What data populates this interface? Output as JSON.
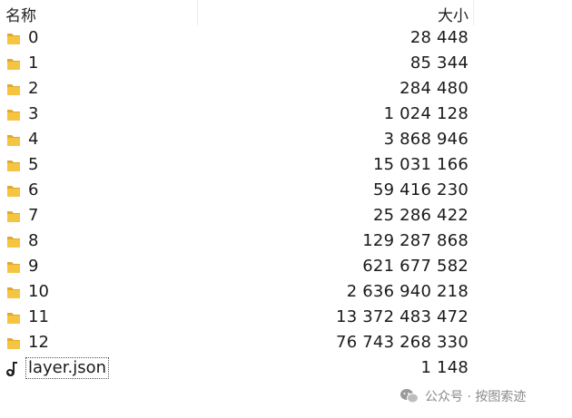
{
  "header": {
    "name_label": "名称",
    "size_label": "大小"
  },
  "files": [
    {
      "name": "0",
      "size": "28 448",
      "type": "folder"
    },
    {
      "name": "1",
      "size": "85 344",
      "type": "folder"
    },
    {
      "name": "2",
      "size": "284 480",
      "type": "folder"
    },
    {
      "name": "3",
      "size": "1 024 128",
      "type": "folder"
    },
    {
      "name": "4",
      "size": "3 868 946",
      "type": "folder"
    },
    {
      "name": "5",
      "size": "15 031 166",
      "type": "folder"
    },
    {
      "name": "6",
      "size": "59 416 230",
      "type": "folder"
    },
    {
      "name": "7",
      "size": "25 286 422",
      "type": "folder"
    },
    {
      "name": "8",
      "size": "129 287 868",
      "type": "folder"
    },
    {
      "name": "9",
      "size": "621 677 582",
      "type": "folder"
    },
    {
      "name": "10",
      "size": "2 636 940 218",
      "type": "folder"
    },
    {
      "name": "11",
      "size": "13 372 483 472",
      "type": "folder"
    },
    {
      "name": "12",
      "size": "76 743 268 330",
      "type": "folder"
    },
    {
      "name": "layer.json",
      "size": "1 148",
      "type": "json-file",
      "selected": true
    }
  ],
  "watermark": {
    "text": "公众号 · 按图索迹",
    "icon": "wechat-icon"
  },
  "colors": {
    "folder": "#f5c542",
    "folder_dark": "#e0a82e",
    "selection_border": "#555555"
  }
}
